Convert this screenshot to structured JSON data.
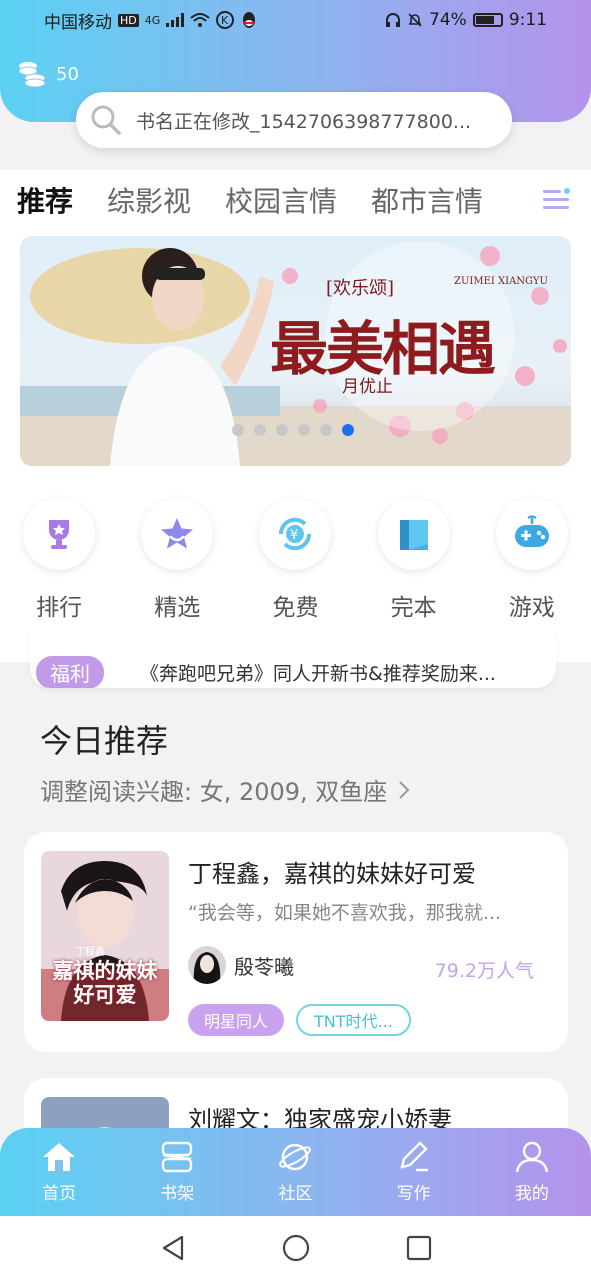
{
  "status_bar": {
    "carrier": "中国移动",
    "hd": "HD",
    "network": "4G",
    "battery": "74%",
    "time": "9:11"
  },
  "header": {
    "coins": "50",
    "search_placeholder": "书名正在修改_1542706398777800..."
  },
  "tabs": [
    {
      "label": "推荐",
      "active": true
    },
    {
      "label": "综影视"
    },
    {
      "label": "校园言情"
    },
    {
      "label": "都市言情"
    }
  ],
  "banner": {
    "series": "[欢乐颂]",
    "title": "最美相遇",
    "author": "月优止",
    "brand": "ZUIMEI XIANGYU",
    "dots": 6,
    "active_dot": 6
  },
  "categories": [
    {
      "label": "排行",
      "icon": "trophy-icon"
    },
    {
      "label": "精选",
      "icon": "star-icon"
    },
    {
      "label": "免费",
      "icon": "free-icon"
    },
    {
      "label": "完本",
      "icon": "book-icon"
    },
    {
      "label": "游戏",
      "icon": "gamepad-icon"
    }
  ],
  "notice": {
    "tag": "福利",
    "text": "《奔跑吧兄弟》同人开新书&推荐奖励来..."
  },
  "recommend": {
    "title": "今日推荐",
    "subtitle": "调整阅读兴趣: 女, 2009, 双鱼座"
  },
  "books": [
    {
      "title": "丁程鑫，嘉祺的妹妹好可爱",
      "desc": "“我会等，如果她不喜欢我，那我就...",
      "author": "殷苓曦",
      "popularity": "79.2万人气",
      "cover_text": "嘉祺的妹妹好可爱",
      "cover_name": "丁程鑫",
      "tags": [
        "明星同人",
        "TNT时代..."
      ]
    },
    {
      "title": "刘耀文：独家盛宠小娇妻"
    }
  ],
  "bottom_nav": [
    {
      "label": "首页",
      "icon": "home-icon"
    },
    {
      "label": "书架",
      "icon": "bookshelf-icon"
    },
    {
      "label": "社区",
      "icon": "community-icon"
    },
    {
      "label": "写作",
      "icon": "write-icon"
    },
    {
      "label": "我的",
      "icon": "profile-icon"
    }
  ],
  "colors": {
    "gradient_start": "#5bd1f2",
    "gradient_end": "#b592ec",
    "accent_purple": "#c8a2ec",
    "accent_cyan": "#74d4e2",
    "active_dot": "#1e6ff0"
  }
}
